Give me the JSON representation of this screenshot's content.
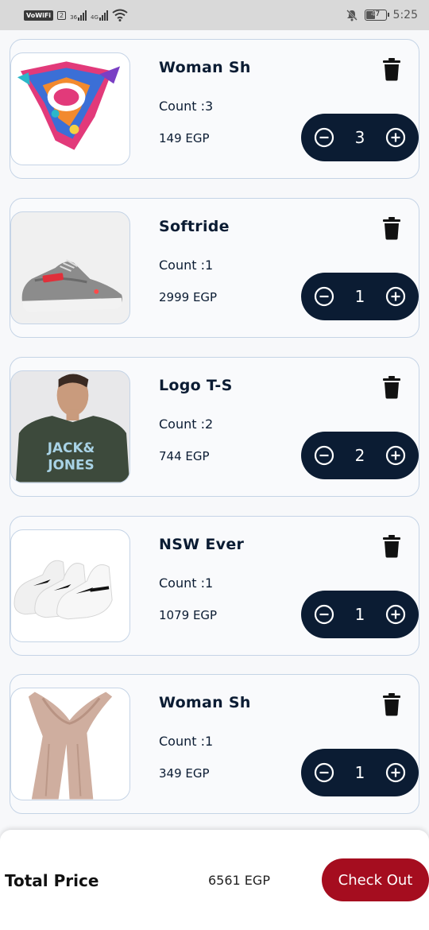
{
  "status_bar": {
    "wifi_calling": "VoWiFi",
    "sim": "2",
    "net1": "36",
    "net2": "4G",
    "battery": "47",
    "time": "5:25",
    "icons": [
      "signal-icon",
      "wifi-icon",
      "mute-icon",
      "battery-icon"
    ]
  },
  "cart": {
    "items": [
      {
        "title": "Woman Sh",
        "count_label": "Count :3",
        "price": "149 EGP",
        "qty": "3",
        "image": "scarf-colorful-image"
      },
      {
        "title": "Softride",
        "count_label": "Count :1",
        "price": "2999 EGP",
        "qty": "1",
        "image": "sneaker-image"
      },
      {
        "title": "Logo T-S",
        "count_label": "Count :2",
        "price": "744 EGP",
        "qty": "2",
        "image": "tshirt-image",
        "image_text": "JACK& JONES"
      },
      {
        "title": "NSW Ever",
        "count_label": "Count :1",
        "price": "1079 EGP",
        "qty": "1",
        "image": "socks-image"
      },
      {
        "title": "Woman Sh",
        "count_label": "Count :1",
        "price": "349 EGP",
        "qty": "1",
        "image": "scarf-beige-image"
      }
    ]
  },
  "footer": {
    "total_label": "Total Price",
    "total_value": "6561 EGP",
    "checkout_label": "Check Out"
  },
  "colors": {
    "primary": "#0b1c33",
    "checkout": "#a50d1f",
    "card_border": "#c5d4e6"
  }
}
